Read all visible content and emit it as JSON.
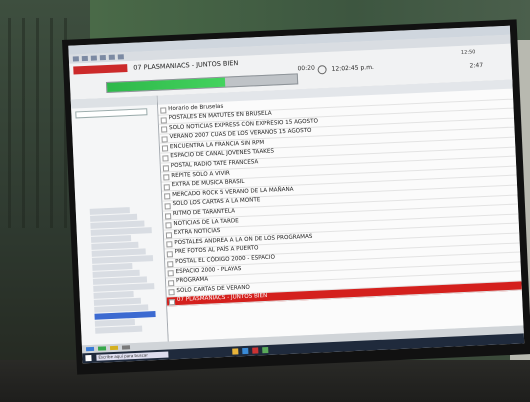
{
  "window": {
    "title": "",
    "station_badge": "",
    "now_playing": "07 PLASMANIACS - JUNTOS BIEN",
    "time_left": "00:20",
    "clock": "12:02:45 p.m.",
    "right_time": "12:50",
    "right_label": "2:47",
    "meter_label": ""
  },
  "left_panel": {
    "header": "",
    "tree_selected_index": 15
  },
  "right_panel": {
    "header": ""
  },
  "log_entries": [
    "Horario de Bruselas",
    "POSTALES EN MATUTES EN BRUSELA",
    "SOLO NOTICIAS EXPRESS CON EXPRESIO 15 AGOSTO",
    "VERANO 2007 CUAS DE LOS VERANOS 15 AGOSTO",
    "ENCUENTRA LA FRANCIA SIN RPM",
    "ESPACIO DE CANAL JOVENES TAAKES",
    "POSTAL RADIO TATE FRANCESA",
    "REPITE SOLO A VIVIR",
    "EXTRA DE MUSICA BRASIL",
    "MERCADO ROCK 5 VERANO DE LA MAÑANA",
    "SOLO LOS CARTAS A LA MONTE",
    "RITMO DE TARANTELA",
    "NOTICIAS DE LA TARDE",
    "EXTRA NOTICIAS",
    "POSTALES ANDREA A LA ON DE LOS PROGRAMAS",
    "PRE FOTOS AL PAÍS A PUERTO",
    "POSTAL EL CÓDIGO 2000 - ESPACIO",
    "ESPACIO 2000 - PLAYAS",
    "PROGRAMA",
    "SOLO CARTAS DE VERANO",
    "07 PLASMANIACS - JUNTOS BIEN"
  ],
  "highlight_index": 20,
  "taskbar": {
    "search_placeholder": "Escribe aquí para buscar"
  },
  "colors": {
    "accent_red": "#d4201d",
    "meter_green": "#3ec455",
    "selection_blue": "#3c6ad1"
  },
  "meter_progress": 0.62
}
